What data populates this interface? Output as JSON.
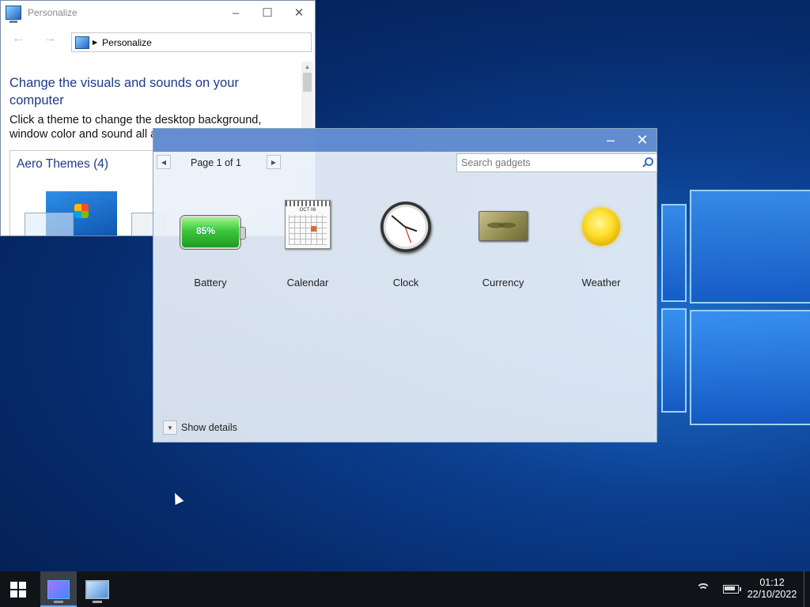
{
  "personalize": {
    "title": "Personalize",
    "breadcrumb": "Personalize",
    "heading": "Change the visuals and sounds on your computer",
    "description": "Click a theme to change the desktop background, window color and sound all at once",
    "themes_group": "Aero Themes (4)"
  },
  "gadgets": {
    "pager_label": "Page 1 of 1",
    "search_placeholder": "Search gadgets",
    "items": [
      {
        "label": "Battery",
        "icon": "battery-icon",
        "value": "85%"
      },
      {
        "label": "Calendar",
        "icon": "calendar-icon",
        "month": "OCT 06"
      },
      {
        "label": "Clock",
        "icon": "clock-icon"
      },
      {
        "label": "Currency",
        "icon": "currency-icon"
      },
      {
        "label": "Weather",
        "icon": "sun-icon"
      }
    ],
    "show_details": "Show details"
  },
  "taskbar": {
    "time": "01:12",
    "date": "22/10/2022"
  }
}
